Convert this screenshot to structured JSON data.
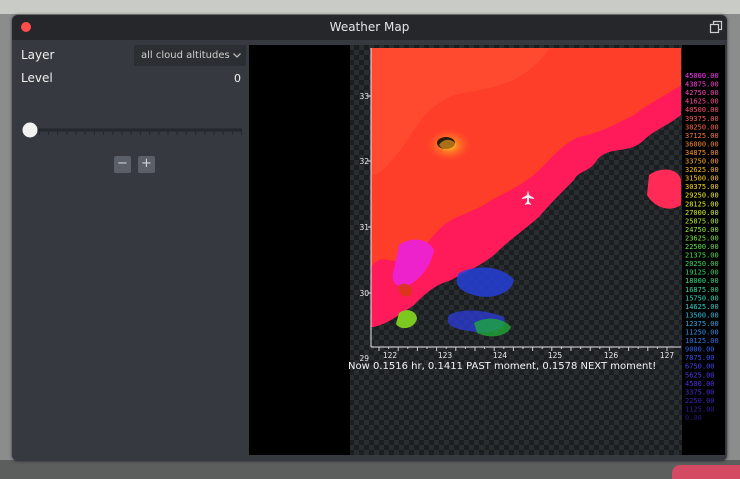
{
  "window": {
    "title": "Weather Map"
  },
  "controls": {
    "layer_label": "Layer",
    "layer_value": "all cloud altitudes",
    "level_label": "Level",
    "level_value": "0",
    "slider_position": 0,
    "decrement_label": "−",
    "increment_label": "+"
  },
  "map": {
    "y_ticks": [
      "33",
      "32",
      "31",
      "30",
      "29"
    ],
    "x_ticks": [
      "122",
      "123",
      "124",
      "125",
      "126",
      "127"
    ],
    "altitude_legend": [
      {
        "label": "45000.00",
        "color": "#ff33ff"
      },
      {
        "label": "43875.00",
        "color": "#ff3fd8"
      },
      {
        "label": "42750.00",
        "color": "#ff45b8"
      },
      {
        "label": "41625.00",
        "color": "#ff4c95"
      },
      {
        "label": "40500.00",
        "color": "#ff5474"
      },
      {
        "label": "39375.00",
        "color": "#ff5c5c"
      },
      {
        "label": "38250.00",
        "color": "#ff6a4a"
      },
      {
        "label": "37125.00",
        "color": "#ff7a3c"
      },
      {
        "label": "36000.00",
        "color": "#ff8a30"
      },
      {
        "label": "34875.00",
        "color": "#ff9a28"
      },
      {
        "label": "33750.00",
        "color": "#ffaa22"
      },
      {
        "label": "32625.00",
        "color": "#ffbb20"
      },
      {
        "label": "31500.00",
        "color": "#ffcc1e"
      },
      {
        "label": "30375.00",
        "color": "#ffdd1e"
      },
      {
        "label": "29250.00",
        "color": "#f4ee20"
      },
      {
        "label": "28125.00",
        "color": "#e4f428"
      },
      {
        "label": "27000.00",
        "color": "#cef030"
      },
      {
        "label": "25875.00",
        "color": "#b4ee36"
      },
      {
        "label": "24750.00",
        "color": "#98ec3c"
      },
      {
        "label": "23625.00",
        "color": "#7ee842"
      },
      {
        "label": "22500.00",
        "color": "#62e44a"
      },
      {
        "label": "21375.00",
        "color": "#4ce050"
      },
      {
        "label": "20250.00",
        "color": "#3ade5a"
      },
      {
        "label": "19125.00",
        "color": "#30dc6e"
      },
      {
        "label": "18000.00",
        "color": "#2edc86"
      },
      {
        "label": "16875.00",
        "color": "#2edca0"
      },
      {
        "label": "15750.00",
        "color": "#2edcba"
      },
      {
        "label": "14625.00",
        "color": "#2ed4d0"
      },
      {
        "label": "13500.00",
        "color": "#2ec0dc"
      },
      {
        "label": "12375.00",
        "color": "#2ea8e4"
      },
      {
        "label": "11250.00",
        "color": "#2e90ea"
      },
      {
        "label": "10125.00",
        "color": "#2e78ee"
      },
      {
        "label": "9000.00",
        "color": "#3262f0"
      },
      {
        "label": "7875.00",
        "color": "#3a50f0"
      },
      {
        "label": "6750.00",
        "color": "#4242ee"
      },
      {
        "label": "5625.00",
        "color": "#4a3aea"
      },
      {
        "label": "4500.00",
        "color": "#5030e2"
      },
      {
        "label": "3375.00",
        "color": "#4a2ad0"
      },
      {
        "label": "2250.00",
        "color": "#3e24b8"
      },
      {
        "label": "1125.00",
        "color": "#301e9a"
      },
      {
        "label": "0.00",
        "color": "#24187c"
      }
    ],
    "status_text": "Now 0.1516 hr, 0.1411 PAST moment, 0.1578 NEXT moment!"
  },
  "colors": {
    "window_bg": "#363a40",
    "titlebar_bg": "#25272b",
    "close_button": "#ff4d4d",
    "cloud_high": "#ff1a5a",
    "cloud_mid": "#ff3e2a"
  }
}
